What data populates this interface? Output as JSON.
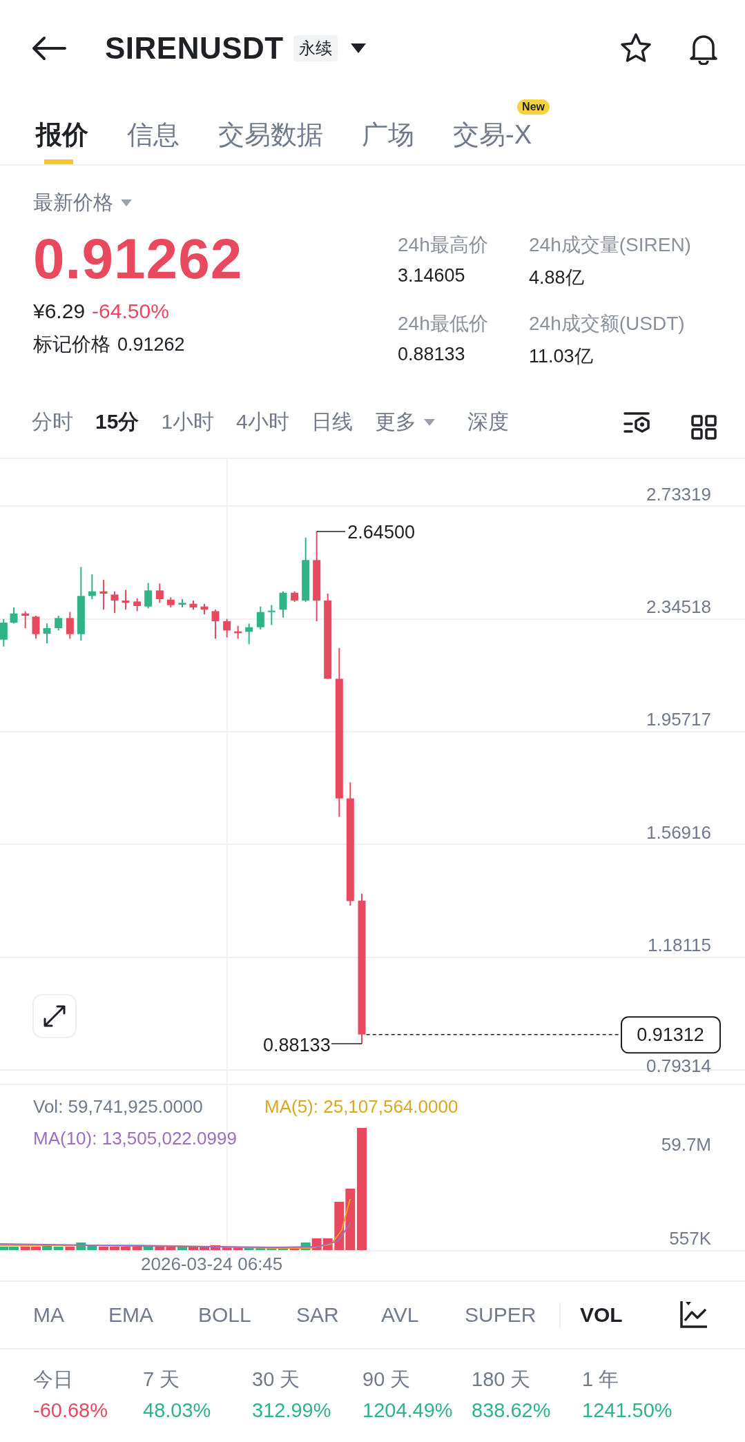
{
  "header": {
    "symbol": "SIRENUSDT",
    "badge": "永续"
  },
  "tabs": [
    {
      "label": "报价",
      "selected": true
    },
    {
      "label": "信息",
      "selected": false
    },
    {
      "label": "交易数据",
      "selected": false
    },
    {
      "label": "广场",
      "selected": false
    },
    {
      "label": "交易-X",
      "selected": false,
      "badge": "New"
    }
  ],
  "price": {
    "selector": "最新价格",
    "last": "0.91262",
    "cny": "¥6.29",
    "change": "-64.50%",
    "mark_label": "标记价格",
    "mark": "0.91262"
  },
  "stats": [
    {
      "label": "24h最高价",
      "value": "3.14605"
    },
    {
      "label": "24h成交量(SIREN)",
      "value": "4.88亿"
    },
    {
      "label": "24h最低价",
      "value": "0.88133"
    },
    {
      "label": "24h成交额(USDT)",
      "value": "11.03亿"
    }
  ],
  "intervals": [
    {
      "label": "分时",
      "selected": false,
      "kind": "plain"
    },
    {
      "label": "15分",
      "selected": true,
      "kind": "plain"
    },
    {
      "label": "1小时",
      "selected": false,
      "kind": "plain"
    },
    {
      "label": "4小时",
      "selected": false,
      "kind": "plain"
    },
    {
      "label": "日线",
      "selected": false,
      "kind": "plain"
    },
    {
      "label": "更多",
      "selected": false,
      "kind": "dropdown"
    },
    {
      "label": "深度",
      "selected": false,
      "kind": "plain"
    }
  ],
  "chart": {
    "price_axis": [
      "2.73319",
      "2.34518",
      "1.95717",
      "1.56916",
      "1.18115",
      "0.79314"
    ],
    "high_label": "2.64500",
    "low_label": "0.88133",
    "last_price": "0.91312"
  },
  "volume": {
    "vol": "Vol: 59,741,925.0000",
    "ma5": "MA(5): 25,107,564.0000",
    "ma10": "MA(10): 13,505,022.0999",
    "axis": [
      "59.7M",
      "557K"
    ],
    "time": "2026-03-24 06:45"
  },
  "indicators": [
    {
      "label": "MA",
      "selected": false
    },
    {
      "label": "EMA",
      "selected": false
    },
    {
      "label": "BOLL",
      "selected": false
    },
    {
      "label": "SAR",
      "selected": false
    },
    {
      "label": "AVL",
      "selected": false
    },
    {
      "label": "SUPER",
      "selected": false
    },
    {
      "label": "VOL",
      "selected": true
    }
  ],
  "returns": [
    {
      "period": "今日",
      "value": "-60.68%",
      "kind": "down"
    },
    {
      "period": "7 天",
      "value": "48.03%",
      "kind": "up"
    },
    {
      "period": "30 天",
      "value": "312.99%",
      "kind": "up"
    },
    {
      "period": "90 天",
      "value": "1204.49%",
      "kind": "up"
    },
    {
      "period": "180 天",
      "value": "838.62%",
      "kind": "up"
    },
    {
      "period": "1 年",
      "value": "1241.50%",
      "kind": "up"
    }
  ]
}
